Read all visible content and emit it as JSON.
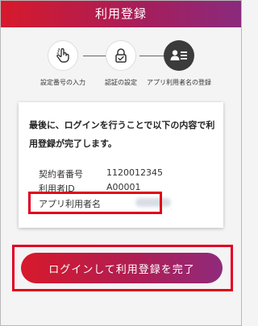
{
  "header": {
    "title": "利用登録"
  },
  "steps": [
    {
      "label": "設定番号の入力",
      "icon": "hand-tap-icon",
      "state": "done"
    },
    {
      "label": "認証の設定",
      "icon": "lock-icon",
      "state": "done"
    },
    {
      "label": "アプリ利用者名の登録",
      "icon": "user-card-icon",
      "state": "active"
    }
  ],
  "card": {
    "message": "最後に、ログインを行うことで以下の内容で利用登録が完了します。",
    "fields": [
      {
        "key": "契約者番号",
        "value": "1120012345"
      },
      {
        "key": "利用者ID",
        "value": "A00001"
      },
      {
        "key": "アプリ利用者名",
        "value": ""
      }
    ]
  },
  "button": {
    "label": "ログインして利用登録を完了"
  },
  "colors": {
    "accent_start": "#d7192b",
    "accent_end": "#8f2a7c",
    "highlight": "#e0001f"
  }
}
